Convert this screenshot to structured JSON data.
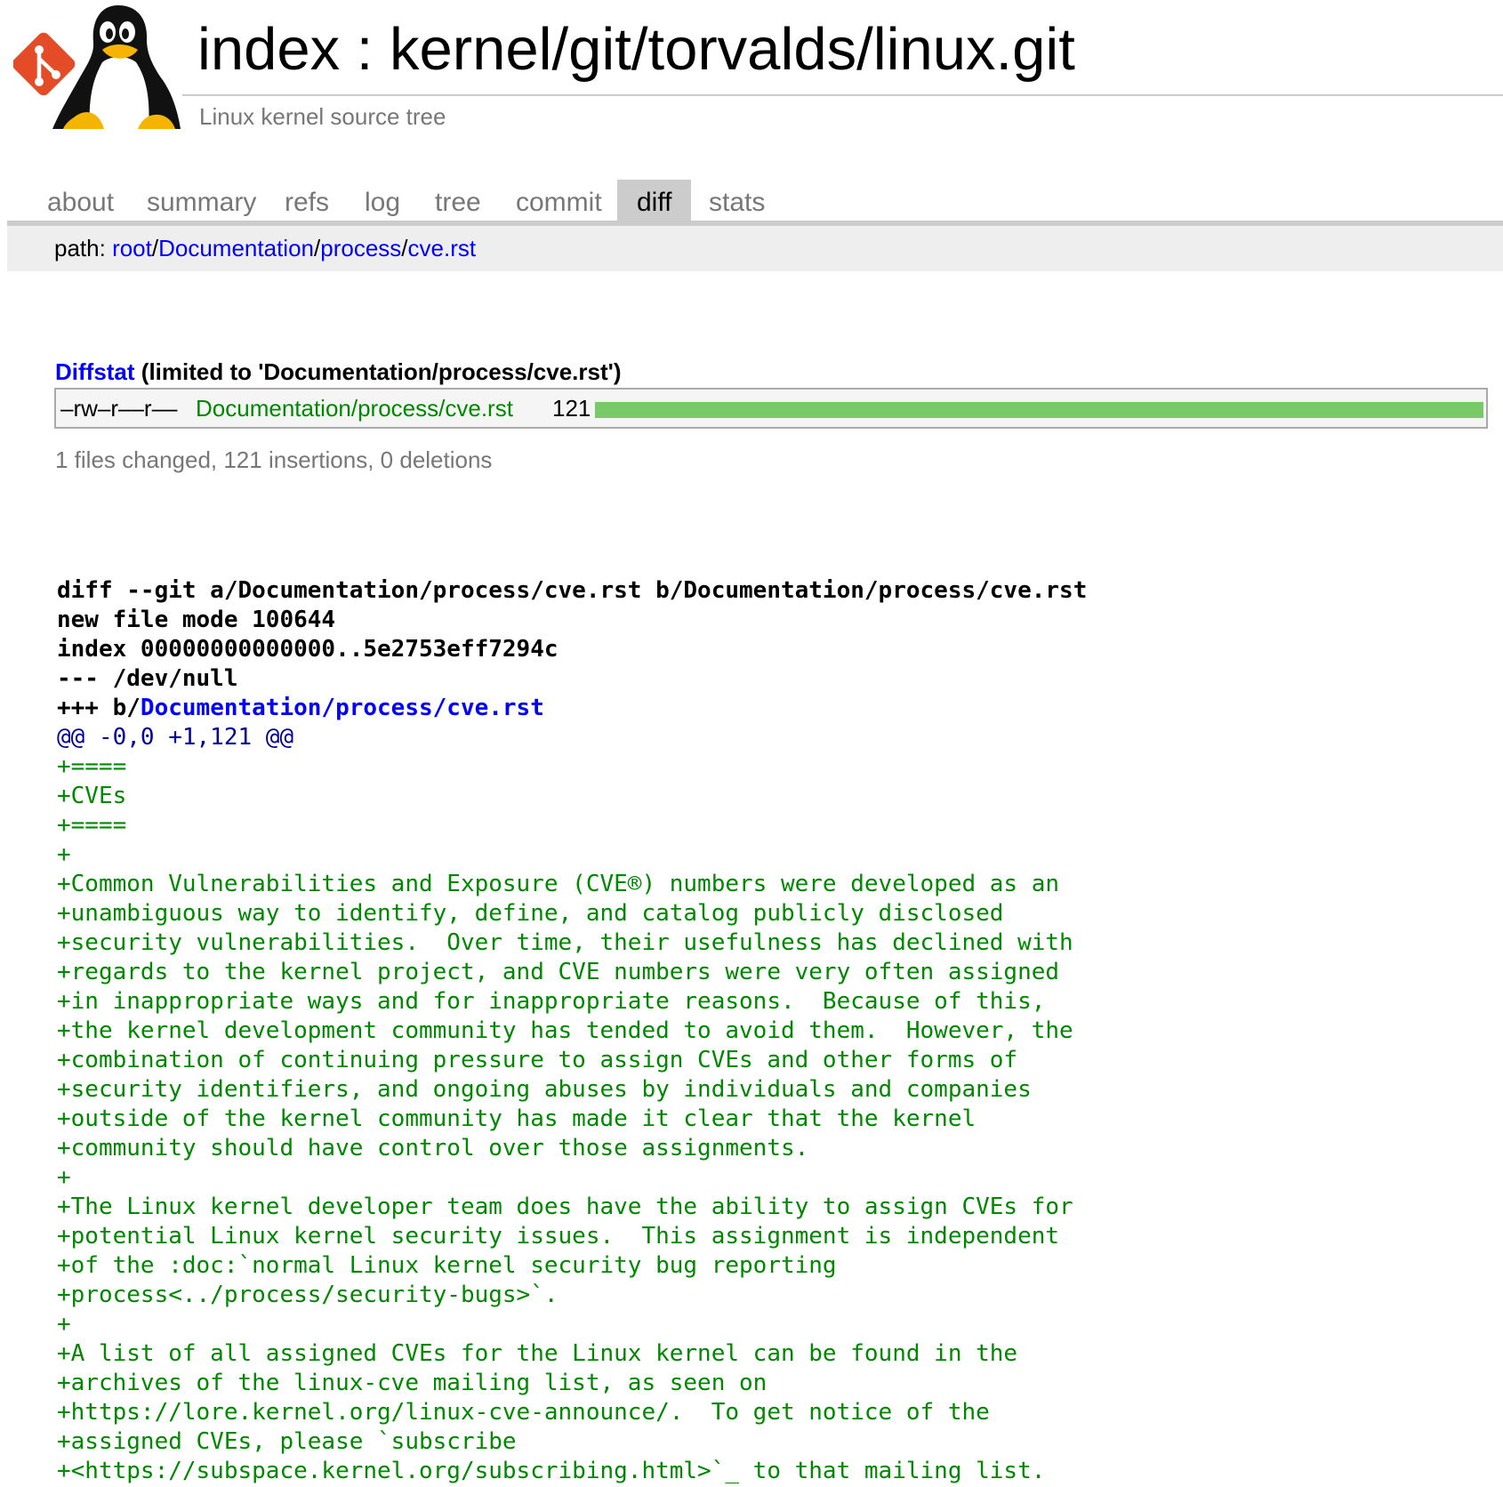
{
  "header": {
    "title": "index : kernel/git/torvalds/linux.git",
    "description": "Linux kernel source tree"
  },
  "tabs": [
    {
      "label": "about",
      "active": false
    },
    {
      "label": "summary",
      "active": false
    },
    {
      "label": "refs",
      "active": false
    },
    {
      "label": "log",
      "active": false
    },
    {
      "label": "tree",
      "active": false
    },
    {
      "label": "commit",
      "active": false
    },
    {
      "label": "diff",
      "active": true
    },
    {
      "label": "stats",
      "active": false
    }
  ],
  "path": {
    "prefix": "path: ",
    "segments": [
      "root",
      "Documentation",
      "process",
      "cve.rst"
    ],
    "separator": "/"
  },
  "diffstat": {
    "link_label": "Diffstat",
    "limited_text": " (limited to 'Documentation/process/cve.rst')",
    "row": {
      "mode": "–rw–r––r––",
      "file": "Documentation/process/cve.rst",
      "count": "121",
      "added_fraction": 1.0
    },
    "summary": "1 files changed, 121 insertions, 0 deletions"
  },
  "diff": {
    "header_lines": [
      "diff --git a/Documentation/process/cve.rst b/Documentation/process/cve.rst",
      "new file mode 100644",
      "index 00000000000000..5e2753eff7294c",
      "--- /dev/null"
    ],
    "plus_prefix": "+++ b/",
    "plus_file": "Documentation/process/cve.rst",
    "hunk": "@@ -0,0 +1,121 @@",
    "added_lines": [
      "+====",
      "+CVEs",
      "+====",
      "+",
      "+Common Vulnerabilities and Exposure (CVE®) numbers were developed as an",
      "+unambiguous way to identify, define, and catalog publicly disclosed",
      "+security vulnerabilities.  Over time, their usefulness has declined with",
      "+regards to the kernel project, and CVE numbers were very often assigned",
      "+in inappropriate ways and for inappropriate reasons.  Because of this,",
      "+the kernel development community has tended to avoid them.  However, the",
      "+combination of continuing pressure to assign CVEs and other forms of",
      "+security identifiers, and ongoing abuses by individuals and companies",
      "+outside of the kernel community has made it clear that the kernel",
      "+community should have control over those assignments.",
      "+",
      "+The Linux kernel developer team does have the ability to assign CVEs for",
      "+potential Linux kernel security issues.  This assignment is independent",
      "+of the :doc:`normal Linux kernel security bug reporting",
      "+process<../process/security-bugs>`.",
      "+",
      "+A list of all assigned CVEs for the Linux kernel can be found in the",
      "+archives of the linux-cve mailing list, as seen on",
      "+https://lore.kernel.org/linux-cve-announce/.  To get notice of the",
      "+assigned CVEs, please `subscribe",
      "+<https://subspace.kernel.org/subscribing.html>`_ to that mailing list."
    ]
  },
  "colors": {
    "link": "#0000ff",
    "added_text": "#008800",
    "hunk_text": "#000099",
    "diffstat_add_bar": "#7ac968",
    "muted_text": "#777777",
    "tab_active_bg": "#cccccc",
    "git_logo": "#e34c26"
  },
  "icons": {
    "logo": "git-logo-with-tux-penguin-icon"
  }
}
